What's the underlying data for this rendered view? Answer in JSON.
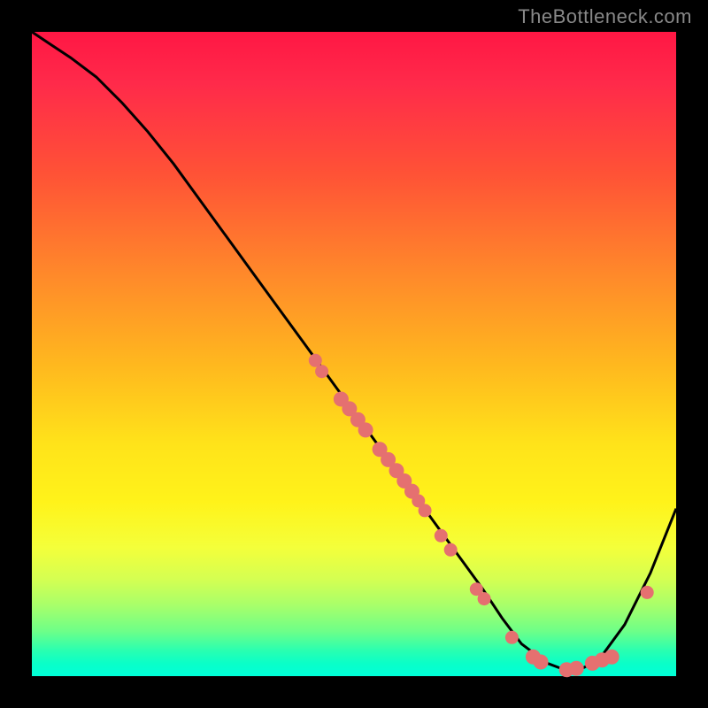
{
  "watermark": "TheBottleneck.com",
  "chart_data": {
    "type": "line",
    "title": "",
    "xlabel": "",
    "ylabel": "",
    "xlim": [
      0,
      100
    ],
    "ylim": [
      0,
      100
    ],
    "series": [
      {
        "name": "curve",
        "x_pct": [
          0,
          3,
          6,
          10,
          14,
          18,
          22,
          26,
          30,
          34,
          38,
          42,
          46,
          50,
          54,
          58,
          62,
          66,
          70,
          73,
          76,
          80,
          84,
          88,
          92,
          96,
          100
        ],
        "y_pct": [
          100,
          98,
          96,
          93,
          89,
          84.5,
          79.5,
          74,
          68.5,
          63,
          57.5,
          52,
          46.5,
          41,
          35.5,
          30,
          24.5,
          19,
          13.5,
          9,
          5,
          2,
          0.5,
          2.5,
          8,
          16,
          26
        ]
      }
    ],
    "dots": [
      {
        "x_pct": 44.0,
        "y_pct": 49.0,
        "r": 7
      },
      {
        "x_pct": 45.0,
        "y_pct": 47.3,
        "r": 7
      },
      {
        "x_pct": 48.0,
        "y_pct": 43.0,
        "r": 8
      },
      {
        "x_pct": 49.3,
        "y_pct": 41.5,
        "r": 8
      },
      {
        "x_pct": 50.6,
        "y_pct": 39.8,
        "r": 8
      },
      {
        "x_pct": 51.8,
        "y_pct": 38.2,
        "r": 8
      },
      {
        "x_pct": 54.0,
        "y_pct": 35.2,
        "r": 8
      },
      {
        "x_pct": 55.3,
        "y_pct": 33.6,
        "r": 8
      },
      {
        "x_pct": 56.6,
        "y_pct": 31.9,
        "r": 8
      },
      {
        "x_pct": 57.8,
        "y_pct": 30.3,
        "r": 8
      },
      {
        "x_pct": 59.0,
        "y_pct": 28.7,
        "r": 8
      },
      {
        "x_pct": 60.0,
        "y_pct": 27.2,
        "r": 7
      },
      {
        "x_pct": 61.0,
        "y_pct": 25.7,
        "r": 7
      },
      {
        "x_pct": 63.5,
        "y_pct": 21.8,
        "r": 7
      },
      {
        "x_pct": 65.0,
        "y_pct": 19.6,
        "r": 7
      },
      {
        "x_pct": 69.0,
        "y_pct": 13.5,
        "r": 7
      },
      {
        "x_pct": 70.2,
        "y_pct": 12.0,
        "r": 7
      },
      {
        "x_pct": 74.5,
        "y_pct": 6.0,
        "r": 7
      },
      {
        "x_pct": 77.8,
        "y_pct": 3.0,
        "r": 8
      },
      {
        "x_pct": 79.0,
        "y_pct": 2.2,
        "r": 8
      },
      {
        "x_pct": 83.0,
        "y_pct": 1.0,
        "r": 8
      },
      {
        "x_pct": 84.5,
        "y_pct": 1.2,
        "r": 8
      },
      {
        "x_pct": 87.0,
        "y_pct": 2.0,
        "r": 8
      },
      {
        "x_pct": 88.5,
        "y_pct": 2.5,
        "r": 8
      },
      {
        "x_pct": 90.0,
        "y_pct": 3.0,
        "r": 8
      },
      {
        "x_pct": 95.5,
        "y_pct": 13.0,
        "r": 7
      }
    ],
    "colors": {
      "curve": "#000000",
      "dot_fill": "#e57070",
      "gradient_top": "#ff1744",
      "gradient_mid": "#ffe31a",
      "gradient_bottom": "#00ffd8"
    }
  }
}
